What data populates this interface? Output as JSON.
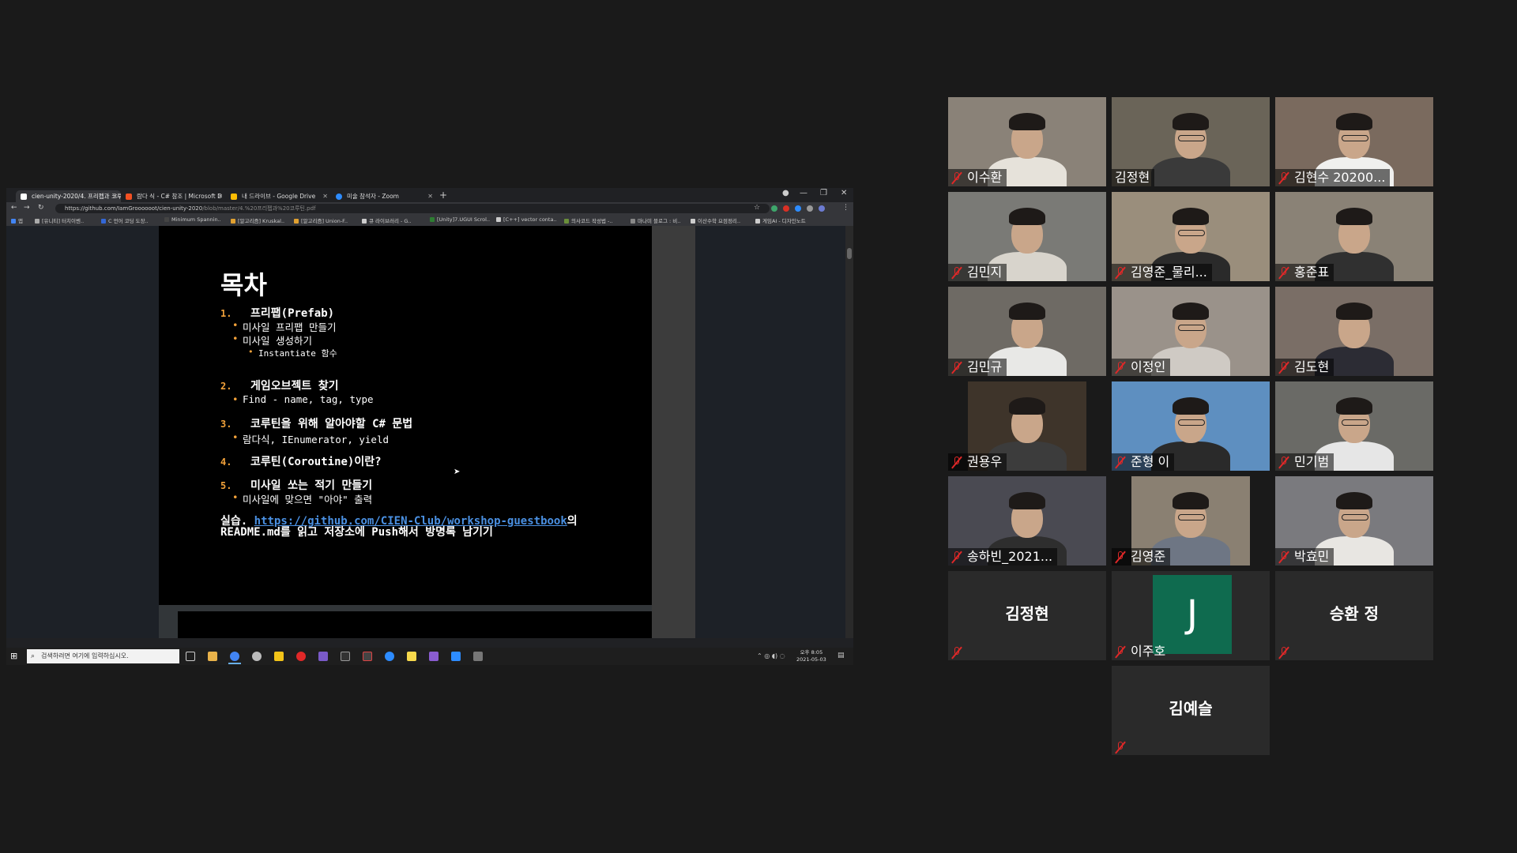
{
  "browser": {
    "tabs": [
      {
        "title": "cien-unity-2020/4. 프리펩과 코루",
        "color": "#ffffff",
        "active": true
      },
      {
        "title": "람다 식 - C# 참조 | Microsoft D",
        "color": "#f25022",
        "active": false
      },
      {
        "title": "내 드라이브 - Google Drive",
        "color": "#fbbc04",
        "active": false
      },
      {
        "title": "미술 참석자 - Zoom",
        "color": "#2d8cff",
        "active": false
      }
    ],
    "new_tab": "+",
    "address_host": "https://github.com/IamGroooooot/cien-unity-2020",
    "address_path": "/blob/master/4.%20프리펩과%20코루틴.pdf",
    "bookmarks": [
      {
        "label": "앱",
        "color": "#4285f4"
      },
      {
        "label": "[유니티] 터치이벤..",
        "color": "#aaaaaa"
      },
      {
        "label": "C 언어 코딩 도장..",
        "color": "#3367d6"
      },
      {
        "label": "Minimum Spannin..",
        "color": "#444444"
      },
      {
        "label": "[알고리즘] Kruskal..",
        "color": "#e0a030"
      },
      {
        "label": "[알고리즘] Union-F..",
        "color": "#e0a030"
      },
      {
        "label": "큐 라이브러리 - G..",
        "color": "#cccccc"
      },
      {
        "label": "[Unity]7.UGUI Scrol..",
        "color": "#2e7d32"
      },
      {
        "label": "[C++] vector conta..",
        "color": "#cccccc"
      },
      {
        "label": "의사코드 작성법 -..",
        "color": "#6a8f3a"
      },
      {
        "label": "마나미 블로그 : 비..",
        "color": "#888888"
      },
      {
        "label": "이산수학 요점정리..",
        "color": "#cccccc"
      },
      {
        "label": "게임AI - 디자인노트",
        "color": "#cccccc"
      }
    ]
  },
  "slide": {
    "title": "목차",
    "items": [
      {
        "num": "1.",
        "text": "프리팹(Prefab)",
        "subs": [
          "미사일 프리팹 만들기",
          "미사일 생성하기"
        ],
        "subsubs": [
          "Instantiate 함수"
        ]
      },
      {
        "num": "2.",
        "text": "게임오브젝트 찾기",
        "subs": [
          "Find - name, tag, type"
        ],
        "subsubs": []
      },
      {
        "num": "3.",
        "text": "코루틴을 위해 알아야할 C# 문법",
        "subs": [
          "람다식, IEnumerator, yield"
        ],
        "subsubs": []
      },
      {
        "num": "4.",
        "text": "코루틴(Coroutine)이란?",
        "subs": [],
        "subsubs": []
      },
      {
        "num": "5.",
        "text": "미사일 쏘는 적기 만들기",
        "subs": [
          "미사일에 맞으면 \"아야\" 출력"
        ],
        "subsubs": []
      }
    ],
    "practice_prefix": "실습.",
    "practice_link": "https://github.com/CIEN-Club/workshop-guestbook",
    "practice_suffix": "의 README.md를 읽고 저장소에 Push해서 방명록 남기기"
  },
  "taskbar": {
    "search_placeholder": "검색하려면 여기에 입력하십시오.",
    "clock_time": "오후 8:05",
    "clock_date": "2021-05-03"
  },
  "participants": [
    {
      "name": "이수환",
      "muted": true,
      "video": true,
      "speaking": false
    },
    {
      "name": "김정현",
      "muted": false,
      "video": true,
      "speaking": true
    },
    {
      "name": "김현수 20200...",
      "muted": true,
      "video": true,
      "speaking": false
    },
    {
      "name": "김민지",
      "muted": true,
      "video": true,
      "speaking": false
    },
    {
      "name": "김영준_물리...",
      "muted": true,
      "video": true,
      "speaking": false
    },
    {
      "name": "홍준표",
      "muted": true,
      "video": true,
      "speaking": false
    },
    {
      "name": "김민규",
      "muted": true,
      "video": true,
      "speaking": false
    },
    {
      "name": "이정인",
      "muted": true,
      "video": true,
      "speaking": false
    },
    {
      "name": "김도현",
      "muted": true,
      "video": true,
      "speaking": false
    },
    {
      "name": "권용우",
      "muted": true,
      "video": true,
      "speaking": false
    },
    {
      "name": "준형 이",
      "muted": true,
      "video": true,
      "speaking": false
    },
    {
      "name": "민기범",
      "muted": true,
      "video": true,
      "speaking": false
    },
    {
      "name": "송하빈_2021...",
      "muted": true,
      "video": true,
      "speaking": false
    },
    {
      "name": "김영준",
      "muted": true,
      "video": true,
      "speaking": false
    },
    {
      "name": "박효민",
      "muted": true,
      "video": true,
      "speaking": false
    },
    {
      "name": "김정현",
      "muted": true,
      "video": false,
      "speaking": false
    },
    {
      "name": "이주호",
      "muted": true,
      "video": false,
      "avatar_letter": "J",
      "speaking": false
    },
    {
      "name": "승환 정",
      "muted": true,
      "video": false,
      "speaking": false
    },
    {
      "name": "김예슬",
      "muted": true,
      "video": false,
      "speaking": false
    }
  ],
  "colors": {
    "accent_speaker": "#c5e14b",
    "muted_icon": "#e02828",
    "slide_number": "#f3a23a",
    "link": "#4a90e2",
    "avatar_bg": "#0f6b4f"
  }
}
